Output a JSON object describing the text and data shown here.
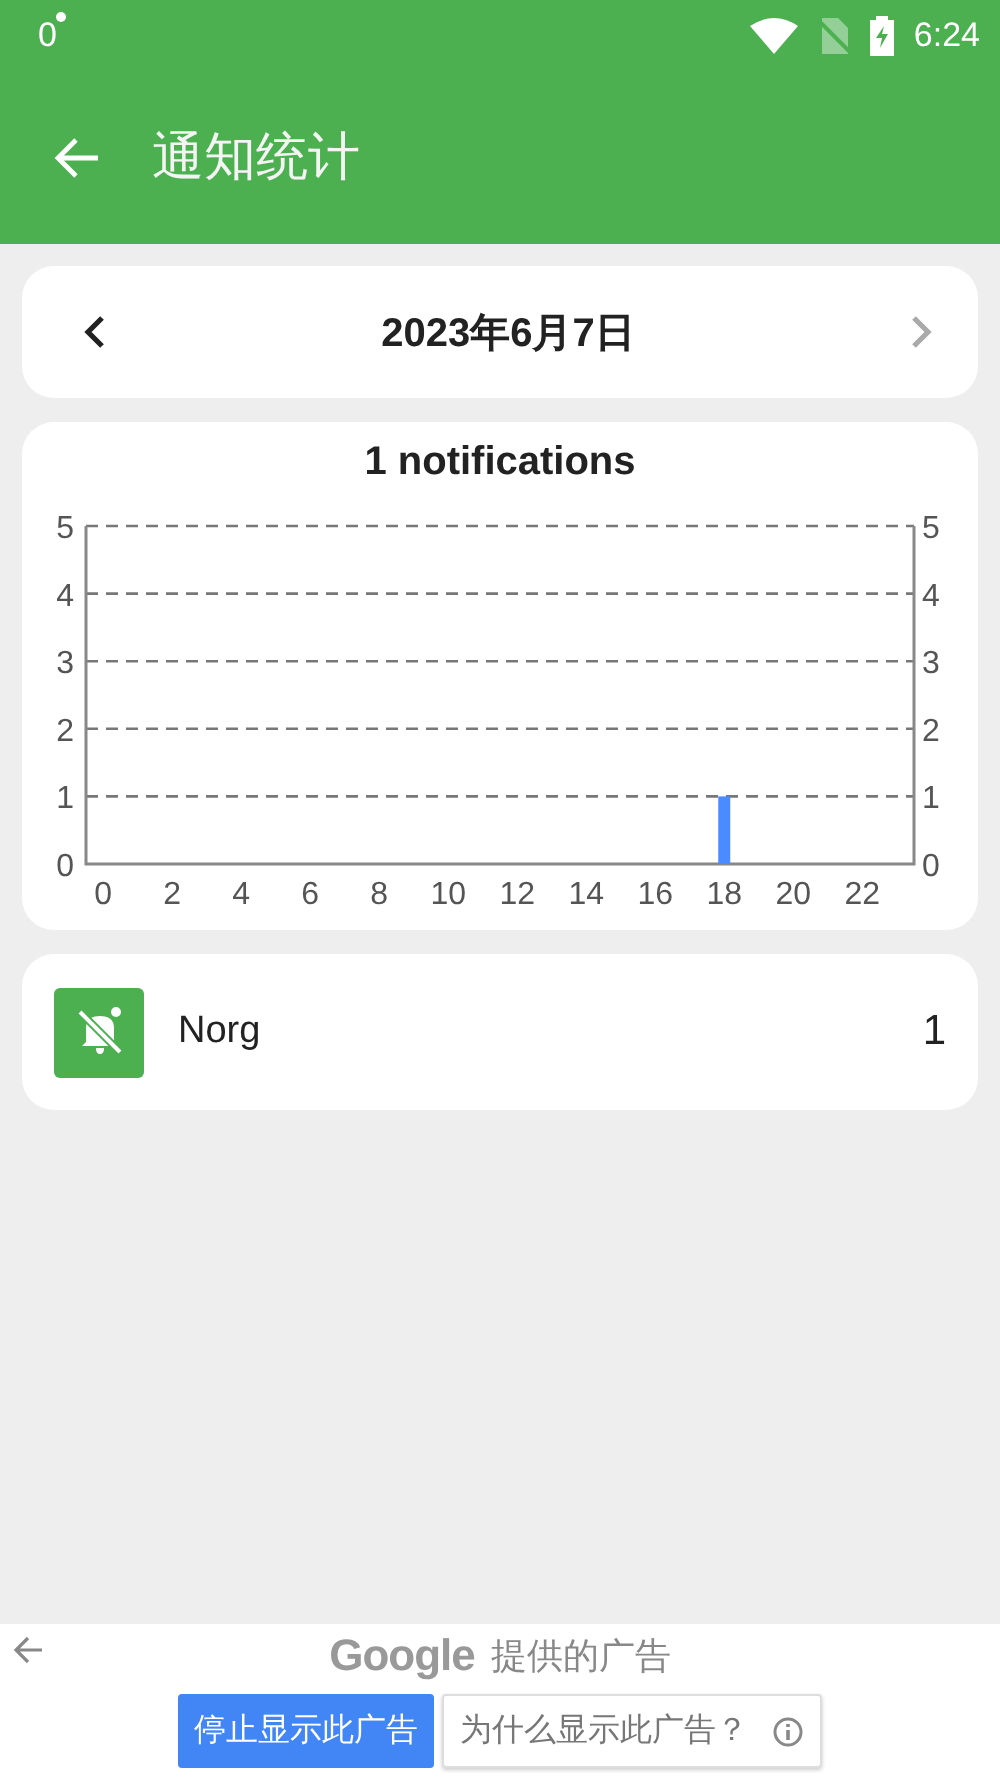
{
  "status_bar": {
    "left_text": "0",
    "time": "6:24"
  },
  "toolbar": {
    "title": "通知统计"
  },
  "date_nav": {
    "date": "2023年6月7日",
    "prev": {
      "disabled": false
    },
    "next": {
      "disabled": true
    }
  },
  "chart": {
    "chart_data": {
      "type": "bar",
      "title": "1 notifications",
      "categories": [
        "0",
        "2",
        "4",
        "6",
        "8",
        "10",
        "12",
        "14",
        "16",
        "18",
        "20",
        "22"
      ],
      "grid": true,
      "values": [
        0,
        0,
        0,
        0,
        0,
        0,
        0,
        0,
        0,
        1,
        0,
        0
      ],
      "ylim": [
        0,
        5
      ],
      "yticks": [
        0,
        1,
        2,
        3,
        4,
        5
      ],
      "y2ticks": [
        0,
        1,
        2,
        3,
        4,
        5
      ],
      "y2lim": [
        0,
        5
      ]
    }
  },
  "apps": [
    {
      "name": "Norg",
      "count": "1"
    }
  ],
  "ad": {
    "brand": "Google",
    "caption": "提供的广告",
    "buttons": [
      {
        "label": "停止显示此广告",
        "kind": "primary"
      },
      {
        "label": "为什么显示此广告？",
        "kind": "info"
      }
    ]
  }
}
